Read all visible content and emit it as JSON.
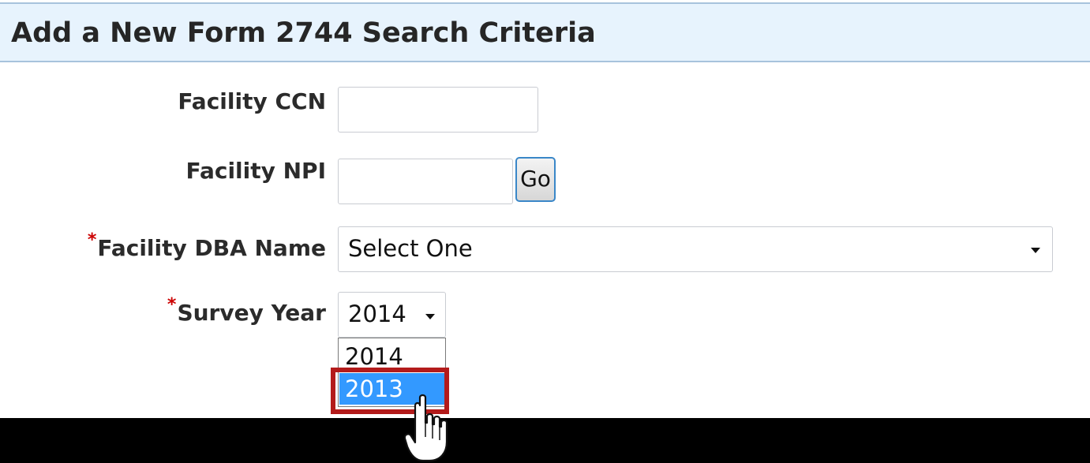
{
  "header": {
    "title": "Add a New Form 2744 Search Criteria"
  },
  "form": {
    "facility_ccn": {
      "label": "Facility CCN",
      "value": ""
    },
    "facility_npi": {
      "label": "Facility NPI",
      "value": "",
      "go_label": "Go"
    },
    "facility_dba": {
      "required_mark": "*",
      "label": "Facility DBA Name",
      "selected": "Select One"
    },
    "survey_year": {
      "required_mark": "*",
      "label": "Survey Year",
      "selected": "2014",
      "options": [
        "2014",
        "2013"
      ],
      "highlighted_option": "2013"
    }
  },
  "colors": {
    "header_bg": "#e7f3fd",
    "header_border": "#a7c3dc",
    "required": "#cc0000",
    "option_highlight": "#3399ff",
    "callout_border": "#b31b1b"
  },
  "icons": {
    "dropdown_arrow": "chevron-down-icon",
    "cursor": "hand-pointer-icon"
  }
}
